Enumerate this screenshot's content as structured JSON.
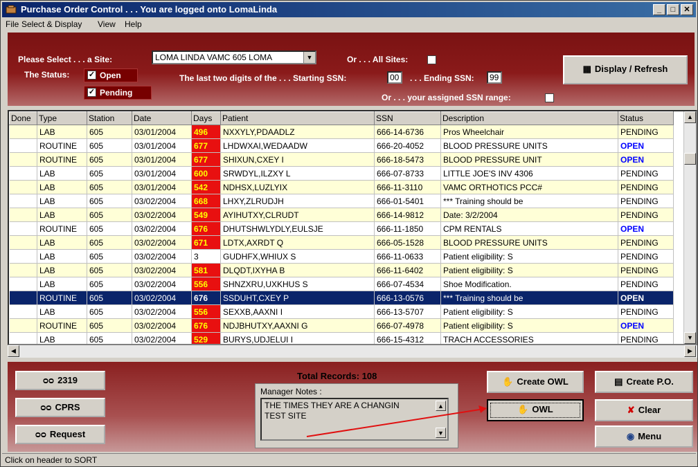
{
  "window": {
    "title": "Purchase Order Control . . . You are logged onto LomaLinda"
  },
  "menu": [
    "File",
    "Select & Display",
    "View",
    "Help"
  ],
  "filters": {
    "site_label": "Please Select . . . a Site:",
    "site_value": "LOMA LINDA VAMC   605   LOMA",
    "all_sites_label": "Or . . . All Sites:",
    "status_label": "The Status:",
    "open_label": "Open",
    "pending_label": "Pending",
    "ssn_label": "The last two digits of the . . . Starting SSN:",
    "start_ssn": "00",
    "end_ssn_label": ". . . Ending SSN:",
    "end_ssn": "99",
    "assigned_label": "Or . . . your assigned SSN range:",
    "display_button": "Display / Refresh"
  },
  "table": {
    "headers": [
      "Done",
      "Type",
      "Station",
      "Date",
      "Days",
      "Patient",
      "SSN",
      "Description",
      "Status"
    ],
    "rows": [
      [
        "",
        "LAB",
        "605",
        "03/01/2004",
        "496",
        "NXXYLY,PDAADLZ",
        "666-14-6736",
        "Pros Wheelchair",
        "PENDING"
      ],
      [
        "",
        "ROUTINE",
        "605",
        "03/01/2004",
        "677",
        "LHDWXAI,WEDAADW",
        "666-20-4052",
        "BLOOD PRESSURE UNITS",
        "OPEN"
      ],
      [
        "",
        "ROUTINE",
        "605",
        "03/01/2004",
        "677",
        "SHIXUN,CXEY I",
        "666-18-5473",
        "BLOOD PRESSURE UNIT",
        "OPEN"
      ],
      [
        "",
        "LAB",
        "605",
        "03/01/2004",
        "600",
        "SRWDYL,ILZXY L",
        "666-07-8733",
        "LITTLE JOE'S INV 4306",
        "PENDING"
      ],
      [
        "",
        "LAB",
        "605",
        "03/01/2004",
        "542",
        "NDHSX,LUZLYIX",
        "666-11-3110",
        "VAMC ORTHOTICS   PCC#",
        "PENDING"
      ],
      [
        "",
        "LAB",
        "605",
        "03/02/2004",
        "668",
        "LHXY,ZLRUDJH",
        "666-01-5401",
        "*** Training should be",
        "PENDING"
      ],
      [
        "",
        "LAB",
        "605",
        "03/02/2004",
        "549",
        "AYIHUTXY,CLRUDT",
        "666-14-9812",
        "Date: 3/2/2004",
        "PENDING"
      ],
      [
        "",
        "ROUTINE",
        "605",
        "03/02/2004",
        "676",
        "DHUTSHWLYDLY,EULSJE",
        "666-11-1850",
        "CPM RENTALS",
        "OPEN"
      ],
      [
        "",
        "LAB",
        "605",
        "03/02/2004",
        "671",
        "LDTX,AXRDT Q",
        "666-05-1528",
        "BLOOD PRESSURE UNITS",
        "PENDING"
      ],
      [
        "",
        "LAB",
        "605",
        "03/02/2004",
        "3",
        "GUDHFX,WHIUX S",
        "666-11-0633",
        "Patient eligibility: S",
        "PENDING"
      ],
      [
        "",
        "LAB",
        "605",
        "03/02/2004",
        "581",
        "DLQDT,IXYHA B",
        "666-11-6402",
        "Patient eligibility: S",
        "PENDING"
      ],
      [
        "",
        "LAB",
        "605",
        "03/02/2004",
        "556",
        "SHNZXRU,UXKHUS S",
        "666-07-4534",
        "Shoe Modification.",
        "PENDING"
      ],
      [
        "",
        "ROUTINE",
        "605",
        "03/02/2004",
        "676",
        "SSDUHT,CXEY P",
        "666-13-0576",
        "*** Training should be",
        "OPEN"
      ],
      [
        "",
        "LAB",
        "605",
        "03/02/2004",
        "556",
        "SEXXB,AAXNI I",
        "666-13-5707",
        "Patient eligibility: S",
        "PENDING"
      ],
      [
        "",
        "ROUTINE",
        "605",
        "03/02/2004",
        "676",
        "NDJBHUTXY,AAXNI G",
        "666-07-4978",
        "Patient eligibility: S",
        "OPEN"
      ],
      [
        "",
        "LAB",
        "605",
        "03/02/2004",
        "529",
        "BURYS,UDJELUI I",
        "666-15-4312",
        "TRACH ACCESSORIES",
        "PENDING"
      ]
    ],
    "selected_row": 12
  },
  "bottom": {
    "btn_2319": "2319",
    "btn_cprs": "CPRS",
    "btn_request": "Request",
    "total_records": "Total Records: 108",
    "notes_caption": "Manager Notes :",
    "notes_line1": "THE TIMES THEY ARE A  CHANGIN",
    "notes_line2": "TEST SITE",
    "btn_create_owl": "Create OWL",
    "btn_owl": "OWL",
    "btn_create_po": "Create P.O.",
    "btn_clear": "Clear",
    "btn_menu": "Menu"
  },
  "statusbar": "Click on header to SORT"
}
